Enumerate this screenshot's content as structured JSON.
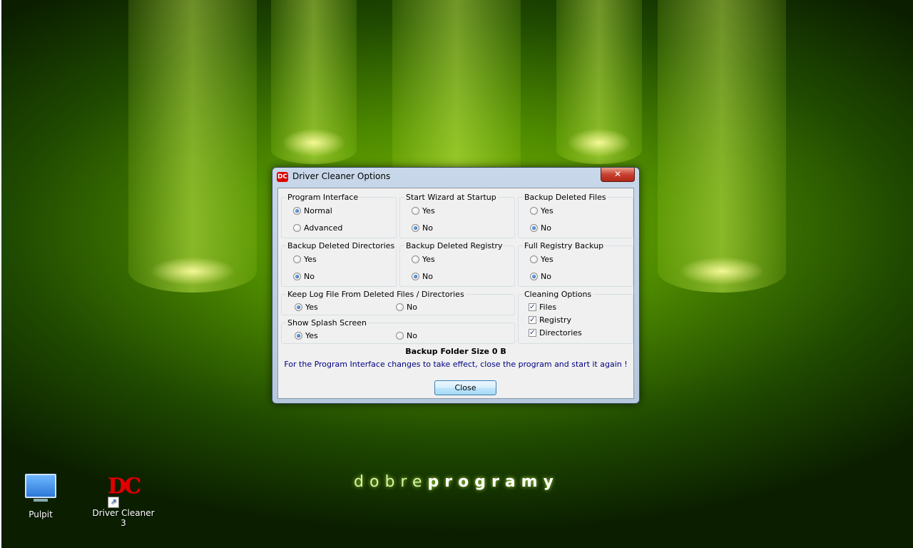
{
  "window": {
    "title": "Driver Cleaner Options",
    "close_glyph": "✕",
    "app_icon_text": "DC"
  },
  "groups": {
    "program_interface": {
      "label": "Program Interface",
      "options": [
        "Normal",
        "Advanced"
      ],
      "selected": "Normal"
    },
    "start_wizard": {
      "label": "Start Wizard at Startup",
      "options": [
        "Yes",
        "No"
      ],
      "selected": "No"
    },
    "backup_files": {
      "label": "Backup Deleted Files",
      "options": [
        "Yes",
        "No"
      ],
      "selected": "No"
    },
    "backup_dirs": {
      "label": "Backup Deleted Directories",
      "options": [
        "Yes",
        "No"
      ],
      "selected": "No"
    },
    "backup_registry": {
      "label": "Backup Deleted Registry",
      "options": [
        "Yes",
        "No"
      ],
      "selected": "No"
    },
    "full_registry": {
      "label": "Full Registry Backup",
      "options": [
        "Yes",
        "No"
      ],
      "selected": "No"
    },
    "keep_log": {
      "label": "Keep Log File From Deleted Files / Directories",
      "options": [
        "Yes",
        "No"
      ],
      "selected": "Yes"
    },
    "splash": {
      "label": "Show Splash Screen",
      "options": [
        "Yes",
        "No"
      ],
      "selected": "Yes"
    },
    "cleaning": {
      "label": "Cleaning Options",
      "items": [
        {
          "label": "Files",
          "checked": true
        },
        {
          "label": "Registry",
          "checked": true
        },
        {
          "label": "Directories",
          "checked": true
        }
      ]
    }
  },
  "info": {
    "backup_size": "Backup Folder Size 0 B",
    "note": "For the Program Interface changes to take effect, close the program and start it again !"
  },
  "close_button_label": "Close",
  "desktop": {
    "icons": [
      {
        "label": "Pulpit",
        "icon": "monitor-icon"
      },
      {
        "label": "Driver Cleaner 3",
        "icon": "driver-cleaner-icon",
        "logo_text": "DC"
      }
    ],
    "brand_light": "dobre",
    "brand_bold": "programy"
  }
}
